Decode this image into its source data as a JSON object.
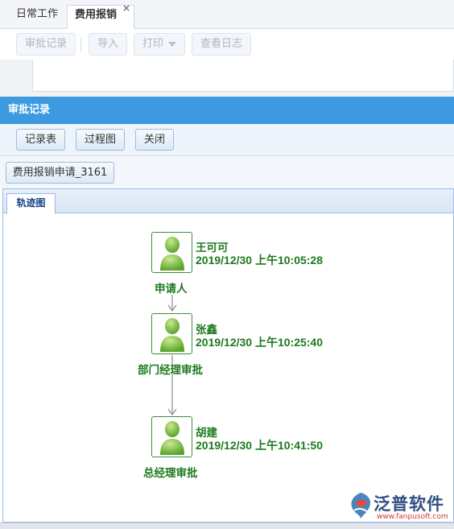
{
  "tabs": [
    {
      "label": "日常工作"
    },
    {
      "label": "费用报销",
      "close": "×"
    }
  ],
  "toolbar": {
    "approval_log": "审批记录",
    "import": "导入",
    "print": "打印",
    "view_log": "查看日志"
  },
  "dialog": {
    "title": "审批记录",
    "buttons": {
      "record_table": "记录表",
      "process_chart": "过程图",
      "close": "关闭"
    },
    "document_button": "费用报销申请_3161",
    "trace_tab": "轨迹图"
  },
  "flow": {
    "accent": "#1d7a1d",
    "nodes": [
      {
        "name": "王可可",
        "time": "2019/12/30 上午10:05:28",
        "step": "申请人"
      },
      {
        "name": "张鑫",
        "time": "2019/12/30 上午10:25:40",
        "step": "部门经理审批"
      },
      {
        "name": "胡建",
        "time": "2019/12/30 上午10:41:50",
        "step": "总经理审批"
      }
    ]
  },
  "watermark": {
    "brand": "泛普软件",
    "url": "www.fanpusoft.com"
  }
}
